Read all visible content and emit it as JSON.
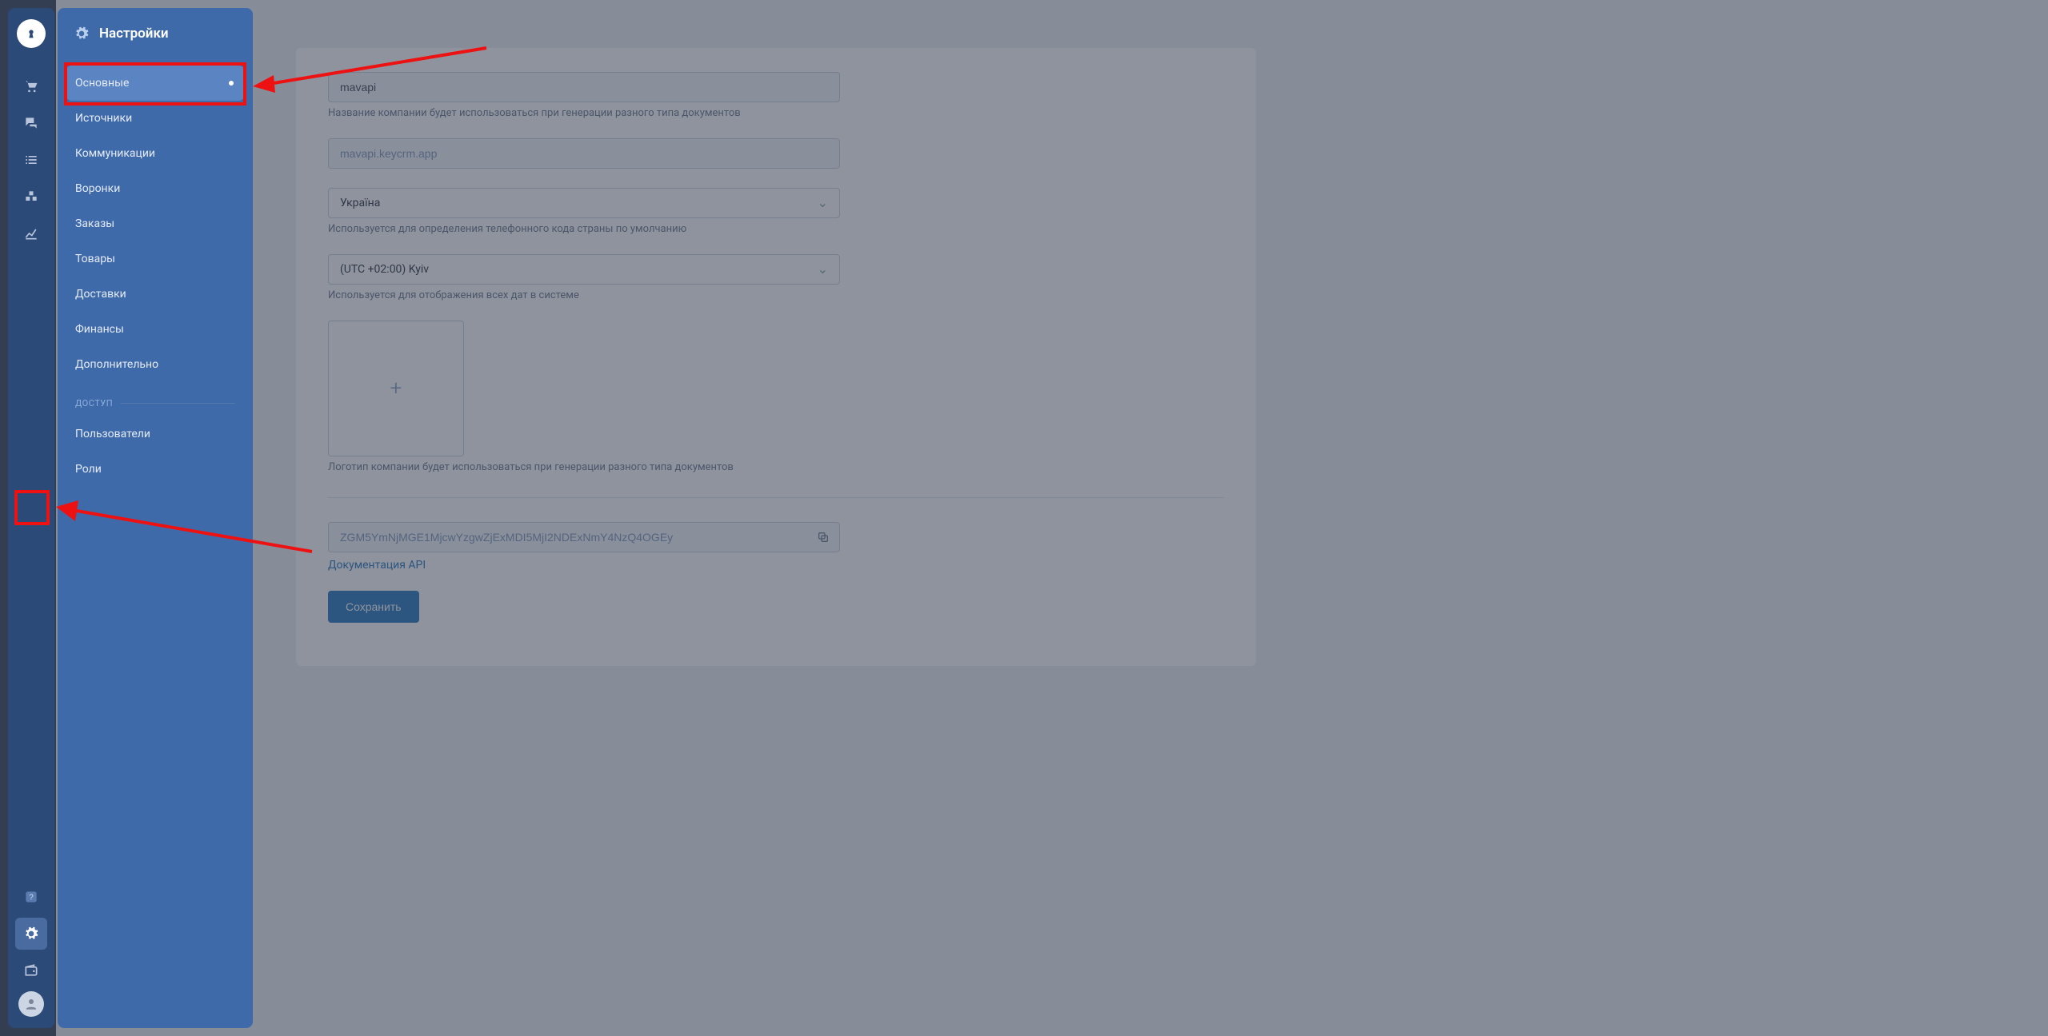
{
  "panel": {
    "title": "Настройки",
    "items": [
      "Основные",
      "Источники",
      "Коммуникации",
      "Воронки",
      "Заказы",
      "Товары",
      "Доставки",
      "Финансы",
      "Дополнительно"
    ],
    "access_label": "ДОСТУП",
    "access_items": [
      "Пользователи",
      "Роли"
    ]
  },
  "form": {
    "company_name": "mavapi",
    "company_name_help": "Название компании будет использоваться при генерации разного типа документов",
    "domain": "mavapi.keycrm.app",
    "country": "Україна",
    "country_help": "Используется для определения телефонного кода страны по умолчанию",
    "timezone": "(UTC +02:00) Kyiv",
    "timezone_help": "Используется для отображения всех дат в системе",
    "logo_help": "Логотип компании будет использоваться при генерации разного типа документов",
    "api_key": "ZGM5YmNjMGE1MjcwYzgwZjExMDI5MjI2NDExNmY4NzQ4OGEy",
    "api_doc_link": "Документация API",
    "save_label": "Сохранить"
  }
}
